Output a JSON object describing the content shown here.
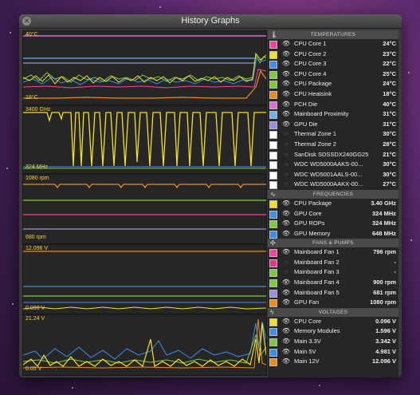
{
  "window": {
    "title": "History Graphs"
  },
  "graphs": {
    "temp": {
      "max": "40°C",
      "min": "18°C"
    },
    "freq": {
      "max": "3400 GHz",
      "min": "324 MHz"
    },
    "fans": {
      "max": "1080 rpm",
      "min": "680 rpm"
    },
    "volt1": {
      "max": "12.096 V",
      "min": "0.096 V"
    },
    "volt2": {
      "max": "21.24 V",
      "min": "0.05 V"
    }
  },
  "sections": {
    "temperatures": "TEMPERATURES",
    "frequencies": "FREQUENCIES",
    "fans": "FANS & PUMPS",
    "voltages": "VOLTAGES"
  },
  "temperatures": [
    {
      "name": "CPU Core 1",
      "value": "24°C",
      "color": "#ff3fa0",
      "eye": true
    },
    {
      "name": "CPU Core 2",
      "value": "23°C",
      "color": "#f2e027",
      "eye": true
    },
    {
      "name": "CPU Core 3",
      "value": "22°C",
      "color": "#3b8fe8",
      "eye": true
    },
    {
      "name": "CPU Core 4",
      "value": "25°C",
      "color": "#7ecb3a",
      "eye": true
    },
    {
      "name": "CPU Package",
      "value": "24°C",
      "color": "#7ecb3a",
      "eye": true
    },
    {
      "name": "CPU Heatsink",
      "value": "18°C",
      "color": "#f08a1e",
      "eye": true
    },
    {
      "name": "PCH Die",
      "value": "40°C",
      "color": "#e06ad8",
      "eye": true
    },
    {
      "name": "Mainboard Proximity",
      "value": "31°C",
      "color": "#6db3e8",
      "eye": true
    },
    {
      "name": "GPU Die",
      "value": "31°C",
      "color": "#9a8ce6",
      "eye": true
    },
    {
      "name": "Thermal Zone 1",
      "value": "30°C",
      "color": "#ffffff",
      "eye": false
    },
    {
      "name": "Thermal Zone 2",
      "value": "28°C",
      "color": "#ffffff",
      "eye": false
    },
    {
      "name": "SanDisk SDSSDX240GG25",
      "value": "21°C",
      "color": "#ffffff",
      "eye": false
    },
    {
      "name": "WDC WD5000AAKS-00...",
      "value": "30°C",
      "color": "#ffffff",
      "eye": false
    },
    {
      "name": "WDC WD5001AALS-00...",
      "value": "30°C",
      "color": "#ffffff",
      "eye": false
    },
    {
      "name": "WDC WD5000AAKX-00...",
      "value": "27°C",
      "color": "#ffffff",
      "eye": false
    }
  ],
  "frequencies": [
    {
      "name": "CPU Package",
      "value": "3.40 GHz",
      "color": "#f2e027",
      "eye": true
    },
    {
      "name": "GPU Core",
      "value": "324 MHz",
      "color": "#3b8fe8",
      "eye": true
    },
    {
      "name": "GPU ROPs",
      "value": "324 MHz",
      "color": "#7ecb3a",
      "eye": true
    },
    {
      "name": "GPU Memory",
      "value": "648 MHz",
      "color": "#3b8fe8",
      "eye": true
    }
  ],
  "fans": [
    {
      "name": "Mainboard Fan 1",
      "value": "796 rpm",
      "color": "#ff3fa0",
      "eye": true
    },
    {
      "name": "Mainboard Fan 2",
      "value": "-",
      "color": "#e8348a",
      "eye": false
    },
    {
      "name": "Mainboard Fan 3",
      "value": "-",
      "color": "#7ecb3a",
      "eye": false
    },
    {
      "name": "Mainboard Fan 4",
      "value": "900 rpm",
      "color": "#7ecb3a",
      "eye": true
    },
    {
      "name": "Mainboard Fan 5",
      "value": "681 rpm",
      "color": "#9a8ce6",
      "eye": true
    },
    {
      "name": "GPU Fan",
      "value": "1080 rpm",
      "color": "#f08a1e",
      "eye": true
    }
  ],
  "voltages": [
    {
      "name": "CPU Core",
      "value": "0.096 V",
      "color": "#f2e027",
      "eye": true
    },
    {
      "name": "Memory Modules",
      "value": "1.596 V",
      "color": "#3b8fe8",
      "eye": true
    },
    {
      "name": "Main 3.3V",
      "value": "3.342 V",
      "color": "#7ecb3a",
      "eye": true
    },
    {
      "name": "Main 5V",
      "value": "4.981 V",
      "color": "#3b8fe8",
      "eye": true
    },
    {
      "name": "Main 12V",
      "value": "12.096 V",
      "color": "#f08a1e",
      "eye": true
    }
  ]
}
